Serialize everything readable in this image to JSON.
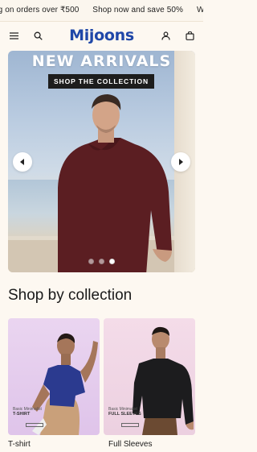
{
  "announcement": {
    "items": [
      "ng on orders over ₹500",
      "Shop now and save 50%",
      "W"
    ]
  },
  "header": {
    "brand": "Mijoons",
    "menu_icon": "hamburger-icon",
    "search_icon": "search-icon",
    "account_icon": "user-icon",
    "cart_icon": "bag-icon",
    "brand_color": "#1f47a8"
  },
  "hero": {
    "title": "NEW ARRIVALS",
    "button_label": "SHOP THE COLLECTION",
    "slide_count": 3,
    "active_slide": 3
  },
  "collections": {
    "title": "Shop by collection",
    "items": [
      {
        "label": "T-shirt",
        "tag_small": "Basic Minimalist",
        "tag_big": "T-SHIRT"
      },
      {
        "label": "Full Sleeves",
        "tag_small": "Basic Minimalist",
        "tag_big": "FULL SLEEVES"
      }
    ]
  }
}
